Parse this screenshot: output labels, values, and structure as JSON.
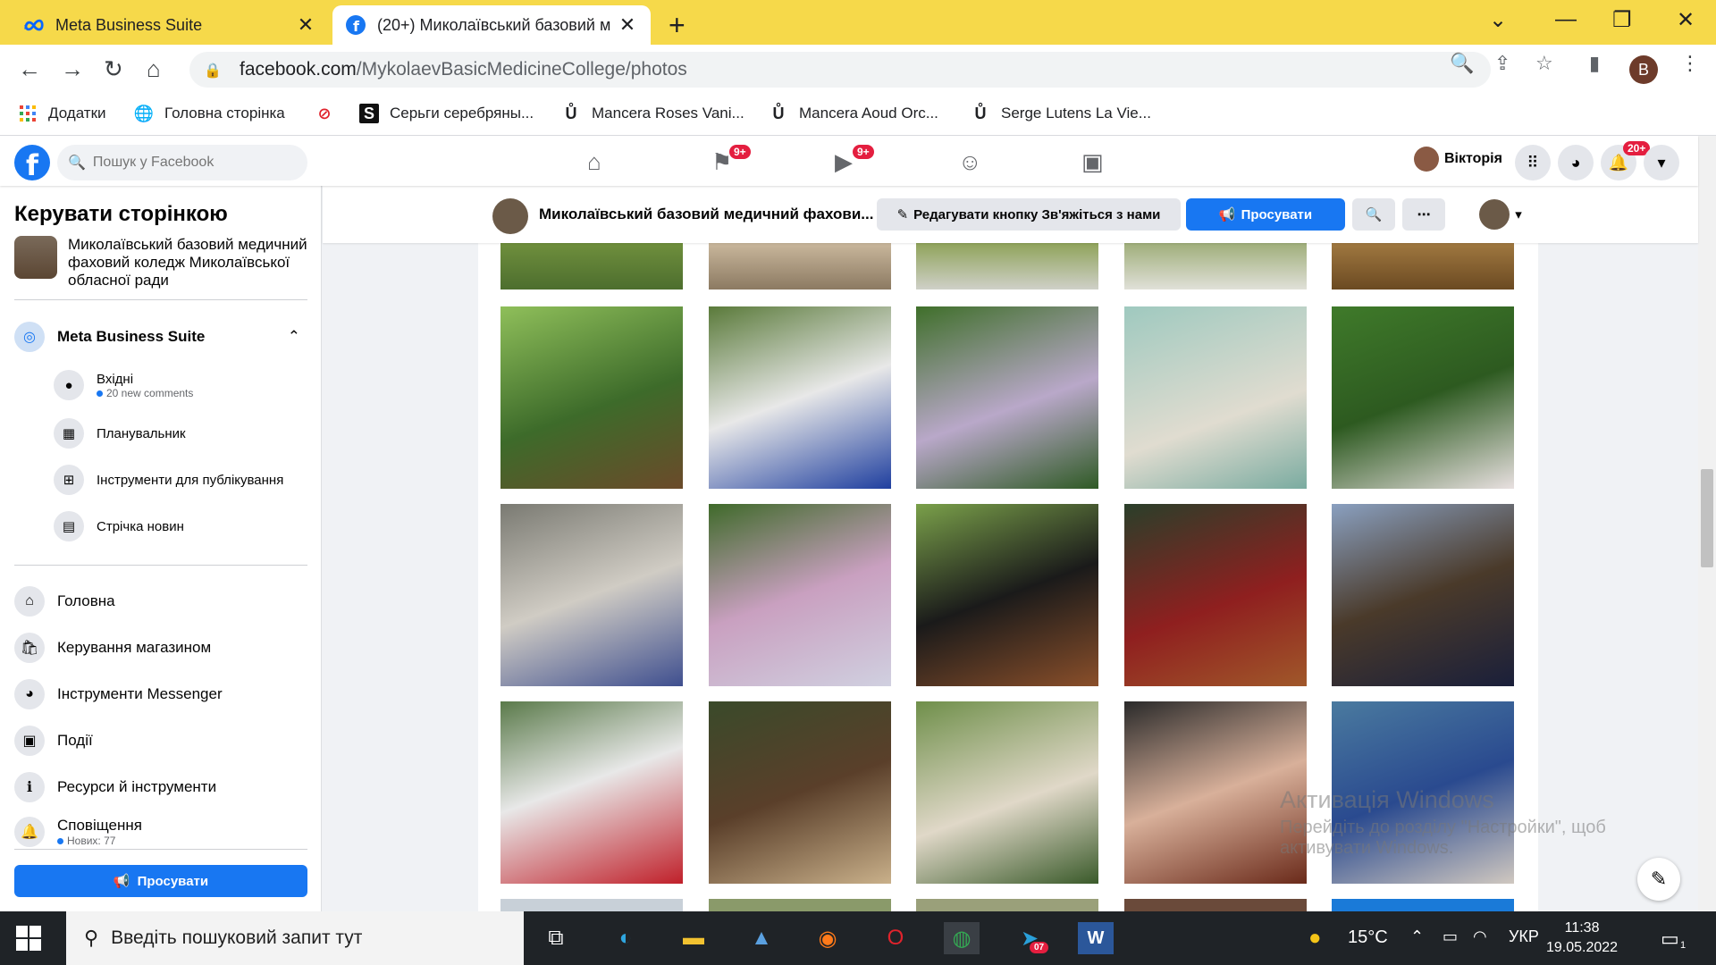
{
  "browser": {
    "tabs": [
      {
        "title": "Meta Business Suite",
        "active": false
      },
      {
        "title": "(20+) Миколаївський базовий м",
        "active": true
      }
    ],
    "url_host": "facebook.com",
    "url_path": "/MykolaevBasicMedicineCollege/photos",
    "profile_letter": "B",
    "bookmarks": [
      {
        "label": "Додатки",
        "icon": "apps-grid-icon"
      },
      {
        "label": "Головна сторінка",
        "icon": "globe-icon"
      },
      {
        "label": "",
        "icon": "opera-icon"
      },
      {
        "label": "Серьги серебряны...",
        "icon": "s-square-icon"
      },
      {
        "label": "Mancera Roses Vani...",
        "icon": "u-icon"
      },
      {
        "label": "Mancera Aoud Orc...",
        "icon": "u-icon"
      },
      {
        "label": "Serge Lutens La Vie...",
        "icon": "u-icon"
      }
    ]
  },
  "fb_header": {
    "search_placeholder": "Пошук у Facebook",
    "badges": {
      "pages": "9+",
      "watch": "9+",
      "notifications": "20+"
    },
    "user_name": "Вікторія"
  },
  "sidebar": {
    "title": "Керувати сторінкою",
    "page_name": "Миколаївський базовий медичний фаховий коледж Миколаївської обласної ради",
    "mbs_label": "Meta Business Suite",
    "mbs_items": [
      {
        "label": "Вхідні",
        "note": "20 new comments"
      },
      {
        "label": "Планувальник",
        "note": ""
      },
      {
        "label": "Інструменти для публікування",
        "note": ""
      },
      {
        "label": "Стрічка новин",
        "note": ""
      }
    ],
    "items": [
      {
        "label": "Головна",
        "icon": "home-icon"
      },
      {
        "label": "Керування магазином",
        "icon": "shop-icon"
      },
      {
        "label": "Інструменти Messenger",
        "icon": "messenger-icon"
      },
      {
        "label": "Події",
        "icon": "calendar-icon"
      },
      {
        "label": "Ресурси й інструменти",
        "icon": "info-icon"
      },
      {
        "label": "Сповіщення",
        "icon": "bell-icon",
        "note": "Нових: 77"
      }
    ],
    "promote_label": "Просувати"
  },
  "page_bar": {
    "title": "Миколаївський базовий медичний фахови...",
    "edit_button": "Редагувати кнопку Зв'яжіться з нами",
    "promote_button": "Просувати"
  },
  "watermark": {
    "line1": "Активація Windows",
    "line2": "Перейдіть до розділу \"Настройки\", щоб активувати Windows."
  },
  "taskbar": {
    "search_placeholder": "Введіть пошуковий запит тут",
    "weather": "15°C",
    "lang": "УКР",
    "time": "11:38",
    "date": "19.05.2022",
    "telegram_badge": "07",
    "notif_count": "1"
  },
  "colors": {
    "fb_blue": "#1877f2",
    "chrome_tab_bar": "#f6d94a",
    "badge_red": "#e41e3f"
  }
}
